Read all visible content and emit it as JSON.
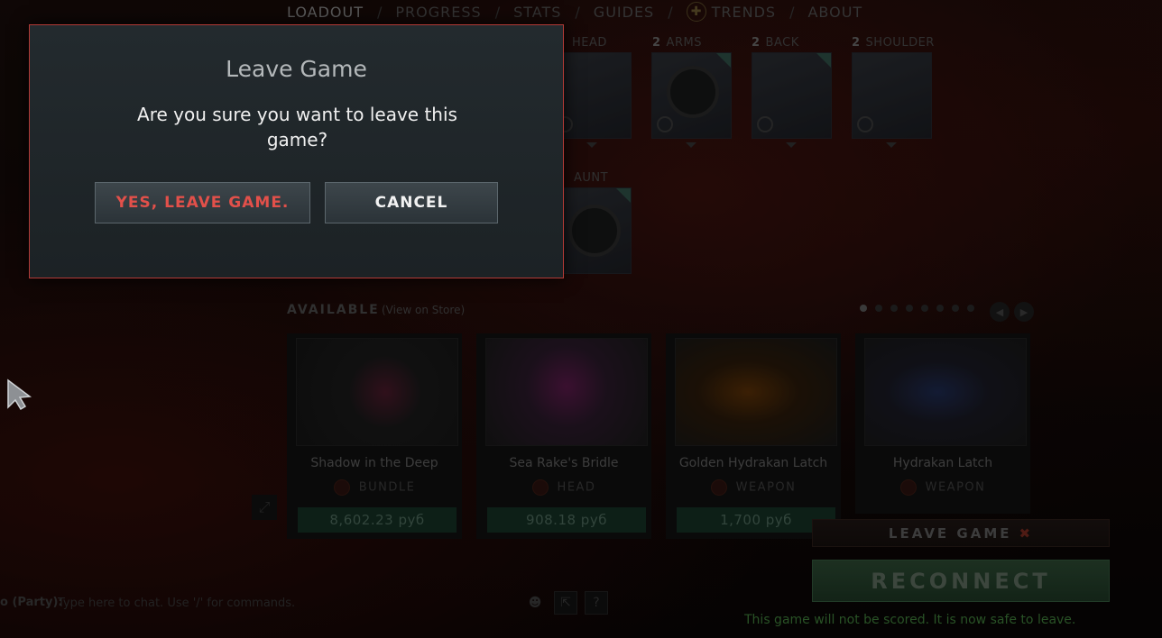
{
  "nav": {
    "items": [
      "LOADOUT",
      "PROGRESS",
      "STATS",
      "GUIDES",
      "TRENDS",
      "ABOUT"
    ],
    "separator": "/",
    "active": "LOADOUT"
  },
  "slots": [
    {
      "count": "",
      "label": "HEAD"
    },
    {
      "count": "2",
      "label": "ARMS"
    },
    {
      "count": "2",
      "label": "BACK"
    },
    {
      "count": "2",
      "label": "SHOULDER"
    },
    {
      "count": "",
      "label": "AUNT"
    }
  ],
  "available": {
    "title": "AVAILABLE",
    "link": "(View on Store)",
    "page_dots": 8,
    "current_page": 1,
    "items": [
      {
        "name": "Shadow in the Deep",
        "type": "BUNDLE",
        "price": "8,602.23 руб",
        "accent": "#7a2a4a"
      },
      {
        "name": "Sea Rake's Bridle",
        "type": "HEAD",
        "price": "908.18 руб",
        "accent": "#8a2a6a"
      },
      {
        "name": "Golden Hydrakan Latch",
        "type": "WEAPON",
        "price": "1,700 руб",
        "accent": "#b06a14"
      },
      {
        "name": "Hydrakan Latch",
        "type": "WEAPON",
        "price": "",
        "accent": "#3a5aa0"
      }
    ]
  },
  "chat": {
    "prefix": "o (Party):",
    "placeholder": "Type here to chat. Use '/' for commands."
  },
  "right_panel": {
    "leave_label": "LEAVE GAME",
    "leave_icon": "close-icon",
    "reconnect_label": "RECONNECT",
    "note": "This game will not be scored.  It is now safe to leave."
  },
  "modal": {
    "title": "Leave Game",
    "message": "Are you sure you want to leave this game?",
    "confirm_label": "YES, LEAVE GAME.",
    "cancel_label": "CANCEL",
    "border_color": "#b33a36",
    "confirm_color": "#e2504a"
  }
}
